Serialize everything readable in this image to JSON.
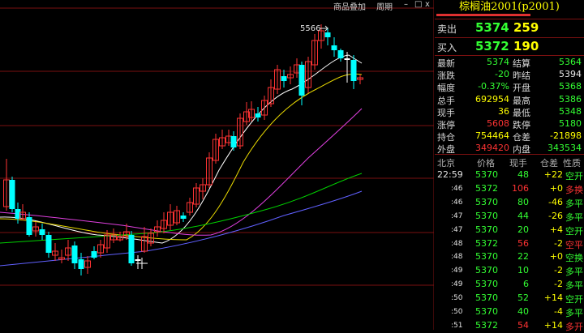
{
  "toolbar": {
    "goods_overlay": "商品叠加",
    "period": "周期",
    "minimize": "–",
    "restore": "□",
    "close": "x"
  },
  "chart": {
    "high_marker_label": "5566"
  },
  "quote": {
    "title": "棕榈油2001(p2001)",
    "sell": {
      "label": "卖出",
      "price": "5374",
      "volume": "259"
    },
    "buy": {
      "label": "买入",
      "price": "5372",
      "volume": "190"
    },
    "stats": [
      {
        "l1": "最新",
        "v1": "5374",
        "c1": "green",
        "l2": "结算",
        "v2": "5364",
        "c2": "green"
      },
      {
        "l1": "涨跌",
        "v1": "-20",
        "c1": "green",
        "l2": "昨结",
        "v2": "5394",
        "c2": "white"
      },
      {
        "l1": "幅度",
        "v1": "-0.37%",
        "c1": "green",
        "l2": "开盘",
        "v2": "5368",
        "c2": "green"
      },
      {
        "l1": "总手",
        "v1": "692954",
        "c1": "yellow",
        "l2": "最高",
        "v2": "5386",
        "c2": "green"
      },
      {
        "l1": "现手",
        "v1": "36",
        "c1": "yellow",
        "l2": "最低",
        "v2": "5348",
        "c2": "green"
      },
      {
        "l1": "涨停",
        "v1": "5608",
        "c1": "red",
        "l2": "跌停",
        "v2": "5180",
        "c2": "green"
      },
      {
        "l1": "持仓",
        "v1": "754464",
        "c1": "yellow",
        "l2": "仓差",
        "v2": "-21898",
        "c2": "yellow"
      },
      {
        "l1": "外盘",
        "v1": "349420",
        "c1": "red",
        "l2": "内盘",
        "v2": "343534",
        "c2": "green"
      }
    ],
    "tick_header": {
      "time": "北京",
      "price": "价格",
      "volume": "现手",
      "change": "仓差",
      "nature": "性质"
    },
    "ticks": [
      {
        "time": "22:59",
        "price": "5370",
        "pc": "green",
        "vol": "48",
        "vc": "green",
        "chg": "+22",
        "cc": "yellow",
        "type": "空开",
        "tc": "green"
      },
      {
        "time": ":46",
        "price": "5372",
        "pc": "green",
        "vol": "106",
        "vc": "red",
        "chg": "+0",
        "cc": "yellow",
        "type": "多换",
        "tc": "red"
      },
      {
        "time": ":46",
        "price": "5370",
        "pc": "green",
        "vol": "80",
        "vc": "green",
        "chg": "-46",
        "cc": "yellow",
        "type": "多平",
        "tc": "green"
      },
      {
        "time": ":47",
        "price": "5370",
        "pc": "green",
        "vol": "44",
        "vc": "green",
        "chg": "-26",
        "cc": "yellow",
        "type": "多平",
        "tc": "green"
      },
      {
        "time": ":47",
        "price": "5370",
        "pc": "green",
        "vol": "20",
        "vc": "green",
        "chg": "+4",
        "cc": "yellow",
        "type": "空开",
        "tc": "green"
      },
      {
        "time": ":48",
        "price": "5372",
        "pc": "green",
        "vol": "56",
        "vc": "red",
        "chg": "-2",
        "cc": "yellow",
        "type": "空平",
        "tc": "red"
      },
      {
        "time": ":48",
        "price": "5370",
        "pc": "green",
        "vol": "22",
        "vc": "green",
        "chg": "+0",
        "cc": "yellow",
        "type": "空换",
        "tc": "green"
      },
      {
        "time": ":49",
        "price": "5370",
        "pc": "green",
        "vol": "10",
        "vc": "green",
        "chg": "-2",
        "cc": "yellow",
        "type": "多平",
        "tc": "green"
      },
      {
        "time": ":49",
        "price": "5370",
        "pc": "green",
        "vol": "6",
        "vc": "green",
        "chg": "-2",
        "cc": "yellow",
        "type": "多平",
        "tc": "green"
      },
      {
        "time": ":50",
        "price": "5370",
        "pc": "green",
        "vol": "52",
        "vc": "green",
        "chg": "+14",
        "cc": "yellow",
        "type": "空开",
        "tc": "green"
      },
      {
        "time": ":50",
        "price": "5370",
        "pc": "green",
        "vol": "40",
        "vc": "green",
        "chg": "-4",
        "cc": "yellow",
        "type": "多平",
        "tc": "green"
      },
      {
        "time": ":51",
        "price": "5372",
        "pc": "green",
        "vol": "54",
        "vc": "red",
        "chg": "+14",
        "cc": "yellow",
        "type": "多开",
        "tc": "red"
      }
    ]
  }
}
